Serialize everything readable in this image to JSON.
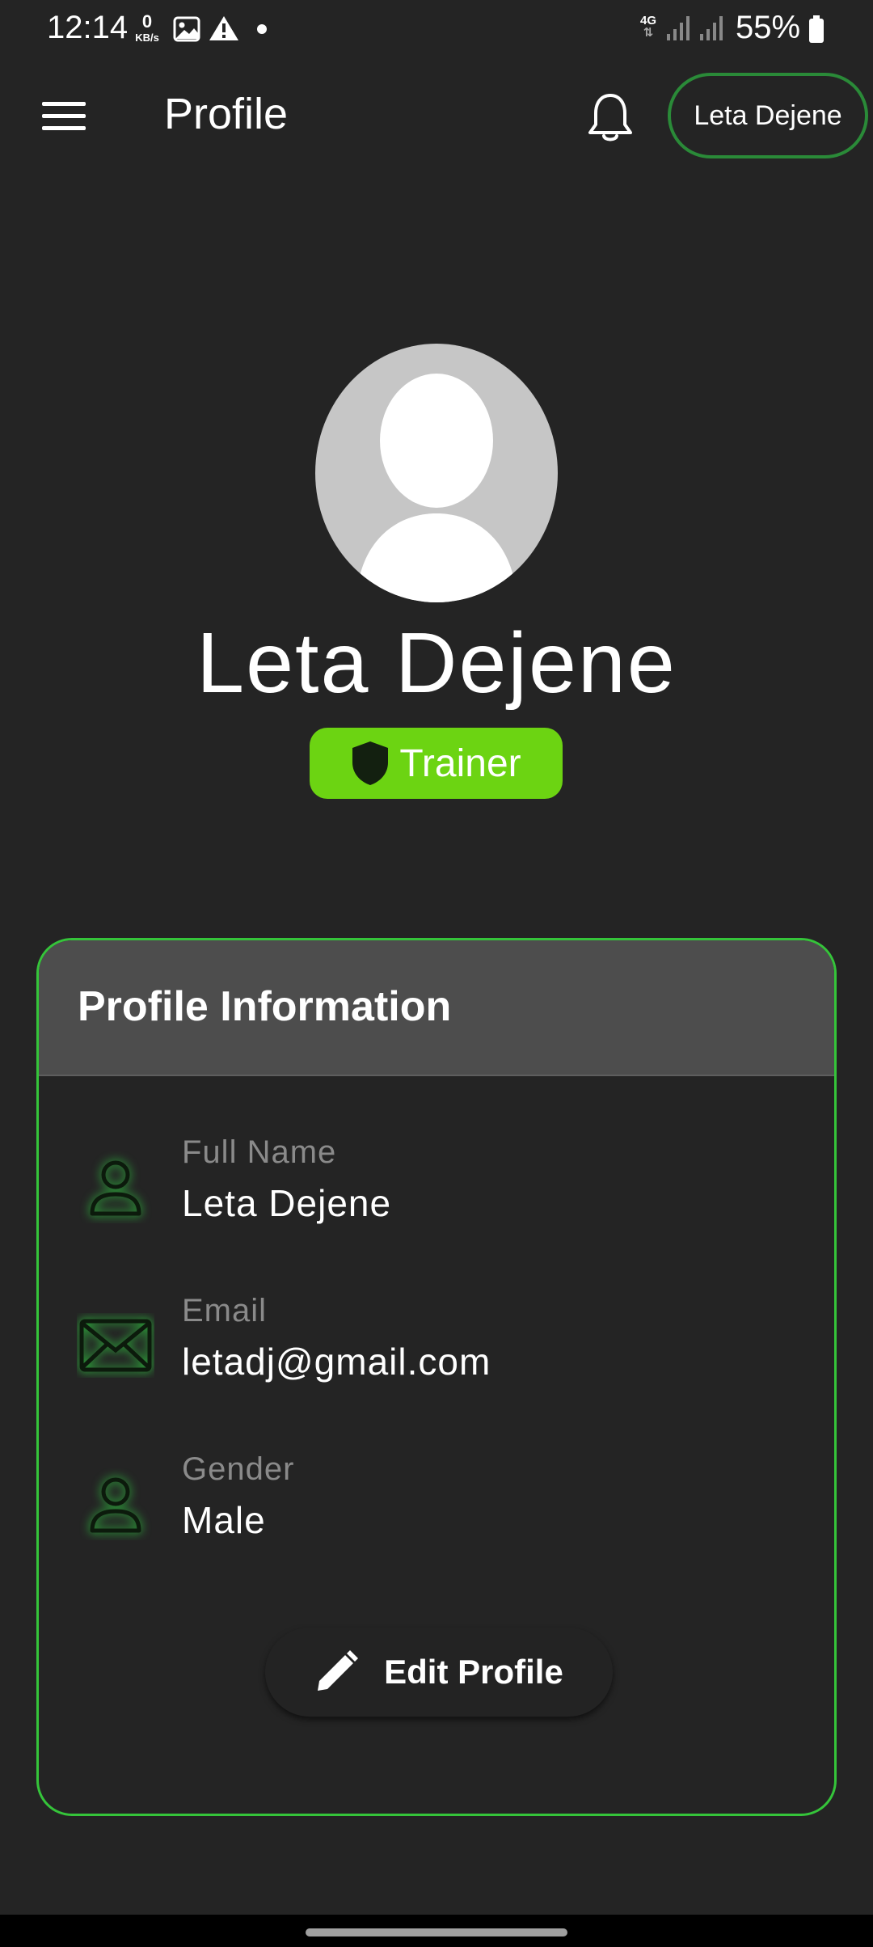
{
  "status_bar": {
    "time": "12:14",
    "net_speed_value": "0",
    "net_speed_unit": "KB/s",
    "network_type": "4G",
    "battery": "55%"
  },
  "app_bar": {
    "title": "Profile",
    "user_button": "Leta Dejene"
  },
  "profile": {
    "name": "Leta Dejene",
    "role": "Trainer"
  },
  "info_card": {
    "title": "Profile Information",
    "rows": [
      {
        "label": "Full Name",
        "value": "Leta Dejene",
        "icon": "person-icon"
      },
      {
        "label": "Email",
        "value": "letadj@gmail.com",
        "icon": "mail-icon"
      },
      {
        "label": "Gender",
        "value": "Male",
        "icon": "person-icon"
      }
    ],
    "edit_button": "Edit Profile"
  },
  "colors": {
    "background": "#242424",
    "accent_green": "#35c43a",
    "badge_green": "#6cd412",
    "card_header": "#4d4d4d"
  }
}
